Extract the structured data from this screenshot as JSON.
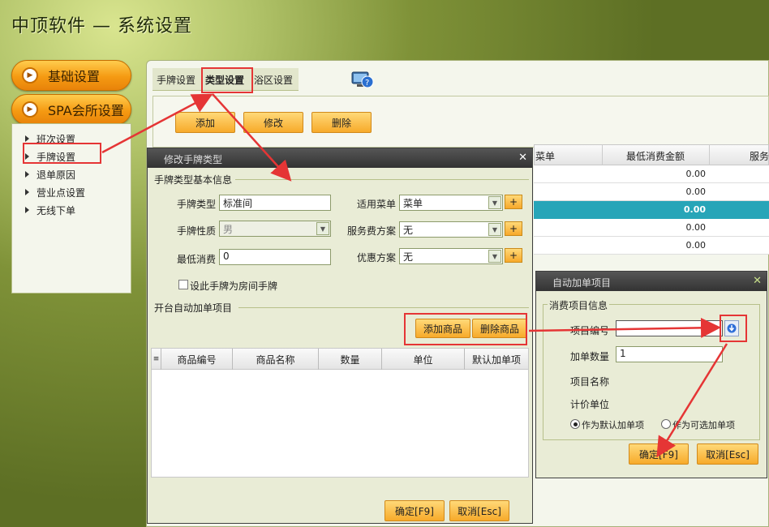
{
  "app": {
    "title": "中顶软件 — 系统设置"
  },
  "nav": {
    "basic": "基础设置",
    "spa": "SPA会所设置"
  },
  "sidebar": {
    "items": [
      "班次设置",
      "手牌设置",
      "退单原因",
      "营业点设置",
      "无线下单"
    ]
  },
  "tabs": [
    "手牌设置",
    "类型设置",
    "浴区设置"
  ],
  "toolbar": {
    "add": "添加",
    "edit": "修改",
    "delete": "删除"
  },
  "grid": {
    "columns": [
      "菜单",
      "最低消费金额",
      "服务"
    ],
    "min_values": [
      "0.00",
      "0.00",
      "0.00",
      "0.00",
      "0.00"
    ],
    "selected_row": 2
  },
  "dialog1": {
    "title": "修改手牌类型",
    "section_basic": "手牌类型基本信息",
    "type_label": "手牌类型",
    "type_value": "标准间",
    "nature_label": "手牌性质",
    "nature_value": "男",
    "min_label": "最低消费",
    "min_value": "0",
    "menu_label": "适用菜单",
    "menu_value": "菜单",
    "fee_label": "服务费方案",
    "fee_value": "无",
    "discount_label": "优惠方案",
    "discount_value": "无",
    "plus": "+",
    "room_checkbox": "设此手牌为房间手牌",
    "section_auto": "开台自动加单项目",
    "add_goods": "添加商品",
    "del_goods": "删除商品",
    "columns": [
      "商品编号",
      "商品名称",
      "数量",
      "单位",
      "默认加单项"
    ],
    "ok": "确定[F9]",
    "cancel": "取消[Esc]"
  },
  "dialog2": {
    "title": "自动加单项目",
    "section": "消费项目信息",
    "code_label": "项目编号",
    "code_value": "",
    "qty_label": "加单数量",
    "qty_value": "1",
    "name_label": "项目名称",
    "unit_label": "计价单位",
    "radio_default": "作为默认加单项",
    "radio_optional": "作为可选加单项",
    "ok": "确定[F9]",
    "cancel": "取消[Esc]"
  },
  "colors": {
    "accent": "#f7aa2a",
    "selected_row": "#27a5b8",
    "annotation": "#e53535"
  }
}
